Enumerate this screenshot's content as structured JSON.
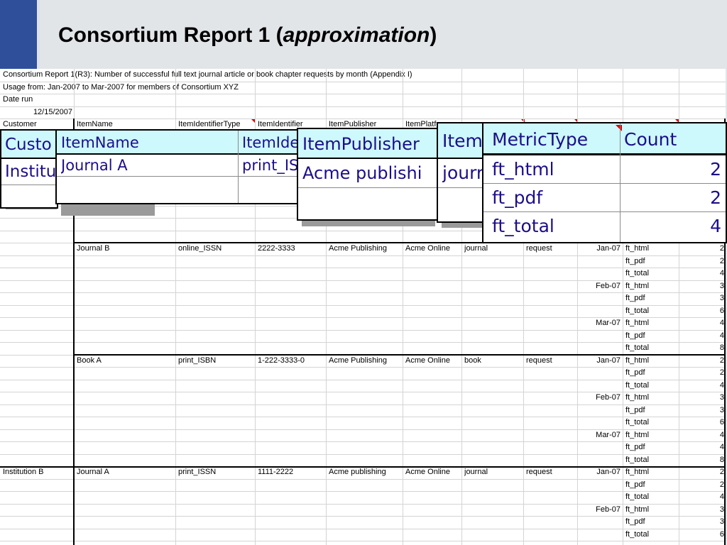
{
  "slide": {
    "title_main": "Consortium Report 1 (",
    "title_italic": "approximation",
    "title_end": ")"
  },
  "sheet": {
    "report_name": "Consortium Report 1(R3): Number of successful full text journal article or book chapter requests by month (Appendix I)",
    "usage": "Usage from: Jan-2007 to Mar-2007 for members of Consortium XYZ",
    "date_label": "Date run",
    "date_value": "12/15/2007",
    "headers": [
      "Customer",
      "ItemName",
      "ItemIdentifierType",
      "ItemIdentifier",
      "ItemPublisher",
      "ItemPlatform"
    ],
    "rows": [
      {
        "customer": "",
        "item": "Journal B",
        "idtype": "online_ISSN",
        "id": "2222-3333",
        "publisher": "Acme Publishing",
        "platform": "Acme Online",
        "datatype": "journal",
        "section": "request",
        "period": "Jan-07",
        "metric": "ft_html",
        "count": "2"
      },
      {
        "customer": "",
        "item": "",
        "idtype": "",
        "id": "",
        "publisher": "",
        "platform": "",
        "datatype": "",
        "section": "",
        "period": "",
        "metric": "ft_pdf",
        "count": "2"
      },
      {
        "customer": "",
        "item": "",
        "idtype": "",
        "id": "",
        "publisher": "",
        "platform": "",
        "datatype": "",
        "section": "",
        "period": "",
        "metric": "ft_total",
        "count": "4"
      },
      {
        "customer": "",
        "item": "",
        "idtype": "",
        "id": "",
        "publisher": "",
        "platform": "",
        "datatype": "",
        "section": "",
        "period": "Feb-07",
        "metric": "ft_html",
        "count": "3"
      },
      {
        "customer": "",
        "item": "",
        "idtype": "",
        "id": "",
        "publisher": "",
        "platform": "",
        "datatype": "",
        "section": "",
        "period": "",
        "metric": "ft_pdf",
        "count": "3"
      },
      {
        "customer": "",
        "item": "",
        "idtype": "",
        "id": "",
        "publisher": "",
        "platform": "",
        "datatype": "",
        "section": "",
        "period": "",
        "metric": "ft_total",
        "count": "6"
      },
      {
        "customer": "",
        "item": "",
        "idtype": "",
        "id": "",
        "publisher": "",
        "platform": "",
        "datatype": "",
        "section": "",
        "period": "Mar-07",
        "metric": "ft_html",
        "count": "4"
      },
      {
        "customer": "",
        "item": "",
        "idtype": "",
        "id": "",
        "publisher": "",
        "platform": "",
        "datatype": "",
        "section": "",
        "period": "",
        "metric": "ft_pdf",
        "count": "4"
      },
      {
        "customer": "",
        "item": "",
        "idtype": "",
        "id": "",
        "publisher": "",
        "platform": "",
        "datatype": "",
        "section": "",
        "period": "",
        "metric": "ft_total",
        "count": "8"
      },
      {
        "customer": "",
        "item": "Book A",
        "idtype": "print_ISBN",
        "id": "1-222-3333-0",
        "publisher": "Acme Publishing",
        "platform": "Acme Online",
        "datatype": "book",
        "section": "request",
        "period": "Jan-07",
        "metric": "ft_html",
        "count": "2"
      },
      {
        "customer": "",
        "item": "",
        "idtype": "",
        "id": "",
        "publisher": "",
        "platform": "",
        "datatype": "",
        "section": "",
        "period": "",
        "metric": "ft_pdf",
        "count": "2"
      },
      {
        "customer": "",
        "item": "",
        "idtype": "",
        "id": "",
        "publisher": "",
        "platform": "",
        "datatype": "",
        "section": "",
        "period": "",
        "metric": "ft_total",
        "count": "4"
      },
      {
        "customer": "",
        "item": "",
        "idtype": "",
        "id": "",
        "publisher": "",
        "platform": "",
        "datatype": "",
        "section": "",
        "period": "Feb-07",
        "metric": "ft_html",
        "count": "3"
      },
      {
        "customer": "",
        "item": "",
        "idtype": "",
        "id": "",
        "publisher": "",
        "platform": "",
        "datatype": "",
        "section": "",
        "period": "",
        "metric": "ft_pdf",
        "count": "3"
      },
      {
        "customer": "",
        "item": "",
        "idtype": "",
        "id": "",
        "publisher": "",
        "platform": "",
        "datatype": "",
        "section": "",
        "period": "",
        "metric": "ft_total",
        "count": "6"
      },
      {
        "customer": "",
        "item": "",
        "idtype": "",
        "id": "",
        "publisher": "",
        "platform": "",
        "datatype": "",
        "section": "",
        "period": "Mar-07",
        "metric": "ft_html",
        "count": "4"
      },
      {
        "customer": "",
        "item": "",
        "idtype": "",
        "id": "",
        "publisher": "",
        "platform": "",
        "datatype": "",
        "section": "",
        "period": "",
        "metric": "ft_pdf",
        "count": "4"
      },
      {
        "customer": "",
        "item": "",
        "idtype": "",
        "id": "",
        "publisher": "",
        "platform": "",
        "datatype": "",
        "section": "",
        "period": "",
        "metric": "ft_total",
        "count": "8"
      },
      {
        "customer": "Institution B",
        "item": "Journal A",
        "idtype": "print_ISSN",
        "id": "1111-2222",
        "publisher": "Acme publishing",
        "platform": "Acme Online",
        "datatype": "journal",
        "section": "request",
        "period": "Jan-07",
        "metric": "ft_html",
        "count": "2"
      },
      {
        "customer": "",
        "item": "",
        "idtype": "",
        "id": "",
        "publisher": "",
        "platform": "",
        "datatype": "",
        "section": "",
        "period": "",
        "metric": "ft_pdf",
        "count": "2"
      },
      {
        "customer": "",
        "item": "",
        "idtype": "",
        "id": "",
        "publisher": "",
        "platform": "",
        "datatype": "",
        "section": "",
        "period": "",
        "metric": "ft_total",
        "count": "4"
      },
      {
        "customer": "",
        "item": "",
        "idtype": "",
        "id": "",
        "publisher": "",
        "platform": "",
        "datatype": "",
        "section": "",
        "period": "Feb-07",
        "metric": "ft_html",
        "count": "3"
      },
      {
        "customer": "",
        "item": "",
        "idtype": "",
        "id": "",
        "publisher": "",
        "platform": "",
        "datatype": "",
        "section": "",
        "period": "",
        "metric": "ft_pdf",
        "count": "3"
      },
      {
        "customer": "",
        "item": "",
        "idtype": "",
        "id": "",
        "publisher": "",
        "platform": "",
        "datatype": "",
        "section": "",
        "period": "",
        "metric": "ft_total",
        "count": "6"
      }
    ]
  },
  "zoom_customer": {
    "header": "Custo",
    "value": "Institu"
  },
  "zoom_item": {
    "h1": "ItemName",
    "h2": "ItemIde",
    "v1": "Journal A",
    "v2": "print_IS"
  },
  "zoom_publisher": {
    "header": "ItemPublisher",
    "value": "Acme publishi"
  },
  "zoom_datatype": {
    "header": "Item",
    "value": "journ"
  },
  "zoom_metric": {
    "h1": "MetricType",
    "h2": "Count",
    "rows": [
      {
        "metric": "ft_html",
        "count": "2"
      },
      {
        "metric": "ft_pdf",
        "count": "2"
      },
      {
        "metric": "ft_total",
        "count": "4"
      }
    ]
  }
}
